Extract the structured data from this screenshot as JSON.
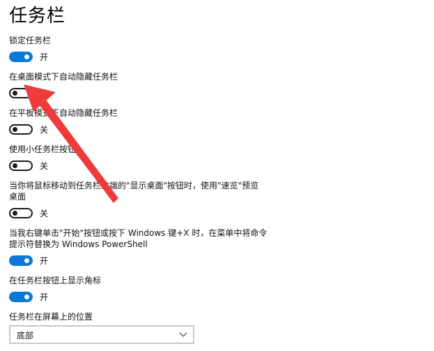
{
  "page": {
    "title": "任务栏"
  },
  "settings": [
    {
      "label": "锁定任务栏",
      "state": "开",
      "on": true
    },
    {
      "label": "在桌面模式下自动隐藏任务栏",
      "state": "关",
      "on": false
    },
    {
      "label": "在平板模式下自动隐藏任务栏",
      "state": "关",
      "on": false
    },
    {
      "label": "使用小任务栏按钮",
      "state": "关",
      "on": false
    },
    {
      "label_line1": "当你将鼠标移动到任务栏末端的\"显示桌面\"按钮时，使用\"速览\"预览",
      "label_line2": "桌面",
      "state": "关",
      "on": false
    },
    {
      "label_line1": "当我右键单击\"开始\"按钮或按下 Windows 键+X 时，在菜单中将命令",
      "label_line2": "提示符替换为 Windows PowerShell",
      "state": "开",
      "on": true
    },
    {
      "label": "在任务栏按钮上显示角标",
      "state": "开",
      "on": true
    }
  ],
  "position": {
    "label": "任务栏在屏幕上的位置",
    "value": "底部"
  },
  "icons": {
    "chevron": "chevron-down-icon",
    "annotation": "red-arrow-annotation-icon"
  },
  "colors": {
    "toggle_on": "#0a78d7",
    "toggle_off_border": "#1a1a1a",
    "annotation_arrow": "#ee3b3b"
  }
}
